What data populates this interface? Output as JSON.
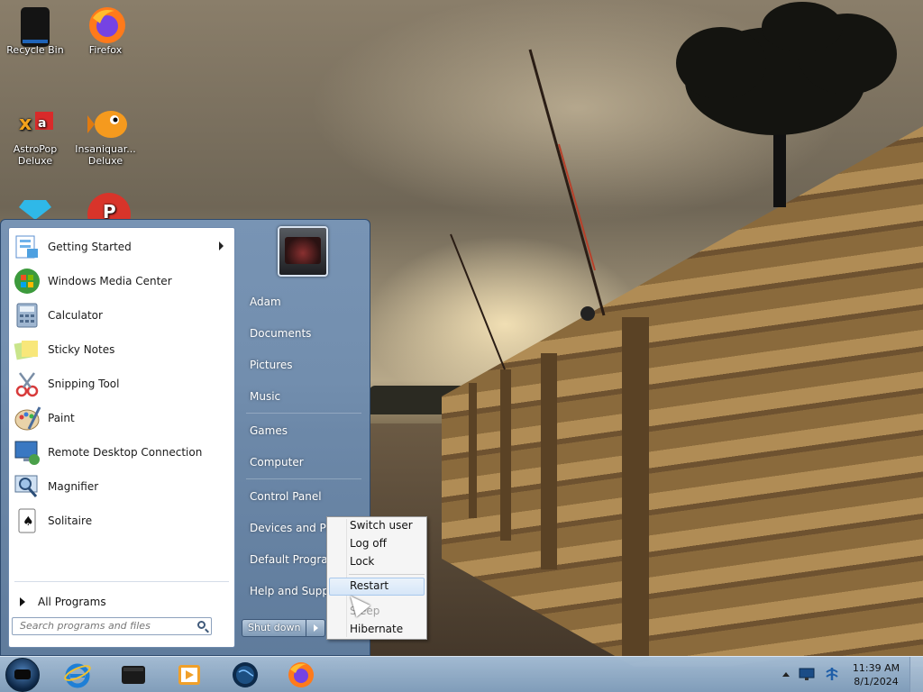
{
  "desktop": {
    "icons": [
      {
        "label": "Recycle Bin",
        "icon": "recycle-bin-icon"
      },
      {
        "label": "Firefox",
        "icon": "firefox-icon"
      },
      {
        "label": "AstroPop Deluxe",
        "icon": "astropop-icon"
      },
      {
        "label": "Insaniquarium Deluxe",
        "icon": "insaniquarium-icon"
      },
      {
        "label": "",
        "icon": "bejeweled-icon"
      },
      {
        "label": "",
        "icon": "zuma-icon"
      }
    ]
  },
  "start_menu": {
    "programs": [
      {
        "label": "Getting Started",
        "icon": "getting-started-icon",
        "has_submenu": true
      },
      {
        "label": "Windows Media Center",
        "icon": "media-center-icon"
      },
      {
        "label": "Calculator",
        "icon": "calculator-icon"
      },
      {
        "label": "Sticky Notes",
        "icon": "sticky-notes-icon"
      },
      {
        "label": "Snipping Tool",
        "icon": "snipping-tool-icon"
      },
      {
        "label": "Paint",
        "icon": "paint-icon"
      },
      {
        "label": "Remote Desktop Connection",
        "icon": "remote-desktop-icon"
      },
      {
        "label": "Magnifier",
        "icon": "magnifier-icon"
      },
      {
        "label": "Solitaire",
        "icon": "solitaire-icon"
      }
    ],
    "all_programs": "All Programs",
    "search_placeholder": "Search programs and files",
    "right_items": [
      {
        "label": "Adam"
      },
      {
        "label": "Documents"
      },
      {
        "label": "Pictures"
      },
      {
        "label": "Music"
      },
      {
        "label": "Games"
      },
      {
        "label": "Computer"
      },
      {
        "label": "Control Panel"
      },
      {
        "label": "Devices and Printers"
      },
      {
        "label": "Default Programs"
      },
      {
        "label": "Help and Support"
      }
    ],
    "shutdown_label": "Shut down"
  },
  "power_menu": {
    "items": [
      {
        "label": "Switch user",
        "state": "normal"
      },
      {
        "label": "Log off",
        "state": "normal"
      },
      {
        "label": "Lock",
        "state": "normal"
      },
      {
        "label": "Restart",
        "state": "highlighted"
      },
      {
        "label": "Sleep",
        "state": "disabled"
      },
      {
        "label": "Hibernate",
        "state": "normal"
      }
    ]
  },
  "taskbar": {
    "pinned": [
      "start-orb-icon",
      "internet-explorer-icon",
      "explorer-icon",
      "media-player-icon",
      "world-icon",
      "firefox-icon"
    ],
    "tray": [
      "tray-up-arrow-icon",
      "network-icon",
      "action-center-icon"
    ],
    "time": "11:39 AM",
    "date": "8/1/2024"
  }
}
